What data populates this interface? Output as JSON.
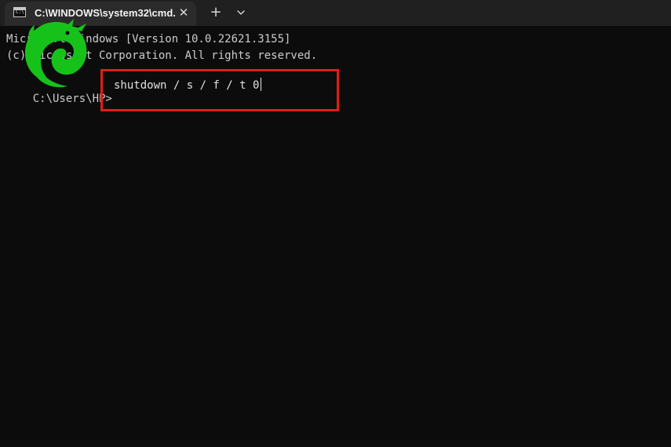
{
  "window": {
    "tab_title": "C:\\WINDOWS\\system32\\cmd.",
    "tab_icon": "command-prompt-icon",
    "tab_icon_text": "C:\\",
    "close_glyph": "✕",
    "new_tab_glyph": "+",
    "dropdown_icon": "chevron-down-icon"
  },
  "console": {
    "lines": [
      "Microsoft Windows [Version 10.0.22621.3155]",
      "(c) Microsoft Corporation. All rights reserved."
    ],
    "prompt": "C:\\Users\\HP>",
    "command": "shutdown / s / f / t 0"
  },
  "highlight": {
    "color": "#e31b1b"
  },
  "watermark": {
    "icon": "green-dragon-logo-icon",
    "color": "#16c21a"
  },
  "colors": {
    "console_bg": "#0c0c0c",
    "titlebar_bg": "#202020",
    "tab_bg": "#2b2b2b",
    "text": "#cccccc"
  }
}
